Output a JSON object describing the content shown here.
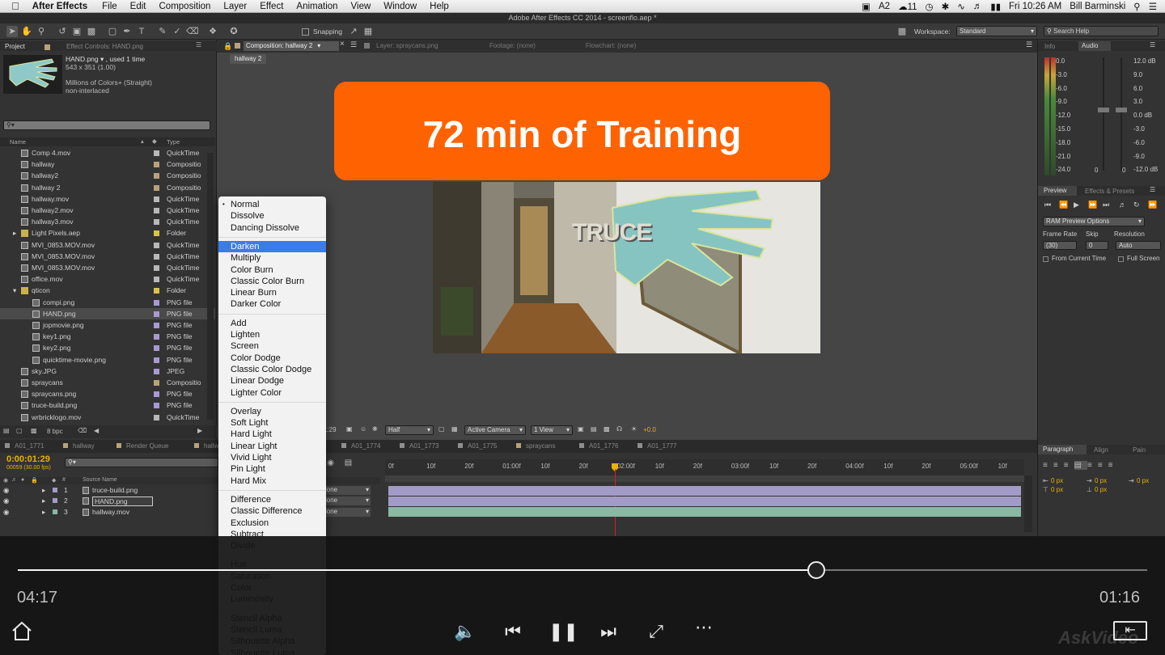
{
  "menubar": {
    "apple": "",
    "app": "After Effects",
    "items": [
      "File",
      "Edit",
      "Composition",
      "Layer",
      "Effect",
      "Animation",
      "View",
      "Window",
      "Help"
    ],
    "right_badges": [
      "2",
      "11"
    ],
    "clock": "Fri 10:26 AM",
    "user": "Bill Barminski"
  },
  "window_title": "Adobe After Effects CC 2014 - screenflo.aep *",
  "toolbar": {
    "snapping": "Snapping",
    "workspace_label": "Workspace:",
    "workspace_value": "Standard",
    "search_placeholder": "Search Help"
  },
  "project": {
    "tab_project": "Project",
    "tab_effect_controls": "Effect Controls: HAND.png",
    "selected_name": "HAND.png ▾ , used 1 time",
    "selected_dims": "543 x 351 (1.00)",
    "selected_colors": "Millions of Colors+ (Straight)",
    "selected_interlace": "non-interlaced",
    "col_name": "Name",
    "col_type": "Type",
    "items": [
      {
        "name": "Comp 4.mov",
        "type": "QuickTime",
        "indent": 0,
        "color": "#b8b8b8"
      },
      {
        "name": "hallway",
        "type": "Compositio",
        "indent": 0,
        "color": "#b8a27a"
      },
      {
        "name": "hallway2",
        "type": "Compositio",
        "indent": 0,
        "color": "#b8a27a"
      },
      {
        "name": "hallway 2",
        "type": "Compositio",
        "indent": 0,
        "color": "#b8a27a"
      },
      {
        "name": "hallway.mov",
        "type": "QuickTime",
        "indent": 0,
        "color": "#b8b8b8"
      },
      {
        "name": "hallway2.mov",
        "type": "QuickTime",
        "indent": 0,
        "color": "#b8b8b8"
      },
      {
        "name": "hallway3.mov",
        "type": "QuickTime",
        "indent": 0,
        "color": "#b8b8b8"
      },
      {
        "name": "Light Pixels.aep",
        "type": "Folder",
        "indent": 0,
        "color": "#d8c44a"
      },
      {
        "name": "MVI_0853.MOV.mov",
        "type": "QuickTime",
        "indent": 0,
        "color": "#b8b8b8"
      },
      {
        "name": "MVI_0853.MOV.mov",
        "type": "QuickTime",
        "indent": 0,
        "color": "#b8b8b8"
      },
      {
        "name": "MVI_0853.MOV.mov",
        "type": "QuickTime",
        "indent": 0,
        "color": "#b8b8b8"
      },
      {
        "name": "office.mov",
        "type": "QuickTime",
        "indent": 0,
        "color": "#b8b8b8"
      },
      {
        "name": "qticon",
        "type": "Folder",
        "indent": 0,
        "color": "#d8c44a"
      },
      {
        "name": "compi.png",
        "type": "PNG file",
        "indent": 1,
        "color": "#a89ad0"
      },
      {
        "name": "HAND.png",
        "type": "PNG file",
        "indent": 1,
        "color": "#a89ad0"
      },
      {
        "name": "jopmovie.png",
        "type": "PNG file",
        "indent": 1,
        "color": "#a89ad0"
      },
      {
        "name": "key1.png",
        "type": "PNG file",
        "indent": 1,
        "color": "#a89ad0"
      },
      {
        "name": "key2.png",
        "type": "PNG file",
        "indent": 1,
        "color": "#a89ad0"
      },
      {
        "name": "quicktime-movie.png",
        "type": "PNG file",
        "indent": 1,
        "color": "#a89ad0"
      },
      {
        "name": "sky.JPG",
        "type": "JPEG",
        "indent": 0,
        "color": "#a89ad0"
      },
      {
        "name": "spraycans",
        "type": "Compositio",
        "indent": 0,
        "color": "#b8a27a"
      },
      {
        "name": "spraycans.png",
        "type": "PNG file",
        "indent": 0,
        "color": "#a89ad0"
      },
      {
        "name": "truce-build.png",
        "type": "PNG file",
        "indent": 0,
        "color": "#a89ad0"
      },
      {
        "name": "wrbricklogo.mov",
        "type": "QuickTime",
        "indent": 0,
        "color": "#b8b8b8"
      }
    ],
    "bpc": "8 bpc"
  },
  "comp": {
    "tab_comp": "Composition: hallway 2",
    "tab_layer": "Layer: spraycans.png",
    "tab_footage": "Footage: (none)",
    "tab_flowchart": "Flowchart: (none)",
    "breadcrumb": "hallway 2",
    "overlay_text": "72 min of Training",
    "truce_text": "TRUCE",
    "footer_time": "1:29",
    "footer_res": "Half",
    "footer_camera": "Active Camera",
    "footer_view": "1 View",
    "footer_exposure": "+0.0"
  },
  "right": {
    "tab_info": "Info",
    "tab_audio": "Audio",
    "audio_left": [
      "0.0",
      "-3.0",
      "-6.0",
      "-9.0",
      "-12.0",
      "-15.0",
      "-18.0",
      "-21.0",
      "-24.0"
    ],
    "audio_right": [
      "12.0 dB",
      "9.0",
      "6.0",
      "3.0",
      "0.0 dB",
      "-3.0",
      "-6.0",
      "-9.0",
      "-12.0 dB"
    ],
    "audio_bottom": [
      "0",
      "0"
    ],
    "tab_preview": "Preview",
    "tab_effects": "Effects & Presets",
    "ram_preview": "RAM Preview Options",
    "frame_rate_label": "Frame Rate",
    "skip_label": "Skip",
    "resolution_label": "Resolution",
    "frame_rate_value": "(30)",
    "skip_value": "0",
    "resolution_value": "Auto",
    "from_current": "From Current Time",
    "full_screen": "Full Screen"
  },
  "timeline": {
    "tabs": [
      "A01_1771",
      "hallway",
      "Render Queue",
      "hallway2",
      "A01_1774",
      "A01_1773",
      "A01_1775",
      "spraycans",
      "A01_1776",
      "A01_1777"
    ],
    "timecode": "0:00:01:29",
    "frames": "00059 (30.00 fps)",
    "col_source": "Source Name",
    "layers": [
      {
        "num": "1",
        "name": "truce-build.png",
        "mode": "lone"
      },
      {
        "num": "2",
        "name": "HAND.png",
        "mode": "lone"
      },
      {
        "num": "3",
        "name": "hallway.mov",
        "mode": "lone"
      }
    ],
    "ruler": [
      "0f",
      "10f",
      "20f",
      "01:00f",
      "10f",
      "20f",
      "02:00f",
      "10f",
      "20f",
      "03:00f",
      "10f",
      "20f",
      "04:00f",
      "10f",
      "20f",
      "05:00f",
      "10f"
    ]
  },
  "paragraph": {
    "tab_paragraph": "Paragraph",
    "tab_align": "Align",
    "tab_paint": "Pain",
    "px_values": [
      "0 px",
      "0 px",
      "0 px",
      "0 px",
      "0 px"
    ]
  },
  "blend_menu": {
    "groups": [
      [
        "Normal",
        "Dissolve",
        "Dancing Dissolve"
      ],
      [
        "Darken",
        "Multiply",
        "Color Burn",
        "Classic Color Burn",
        "Linear Burn",
        "Darker Color"
      ],
      [
        "Add",
        "Lighten",
        "Screen",
        "Color Dodge",
        "Classic Color Dodge",
        "Linear Dodge",
        "Lighter Color"
      ],
      [
        "Overlay",
        "Soft Light",
        "Hard Light",
        "Linear Light",
        "Vivid Light",
        "Pin Light",
        "Hard Mix"
      ],
      [
        "Difference",
        "Classic Difference",
        "Exclusion",
        "Subtract",
        "Divide"
      ],
      [
        "Hue",
        "Saturation",
        "Color",
        "Luminosity"
      ],
      [
        "Stencil Alpha",
        "Stencil Luma",
        "Silhouette Alpha",
        "Silhouette Luma"
      ]
    ],
    "checked": "Normal",
    "highlighted": "Darken"
  },
  "player": {
    "elapsed": "04:17",
    "remaining": "01:16",
    "progress": 0.707,
    "brand": "AskVideo"
  },
  "colors": {
    "accent_orange": "#ff6200",
    "menu_highlight": "#3b7ce8",
    "timecode": "#e8b400"
  }
}
